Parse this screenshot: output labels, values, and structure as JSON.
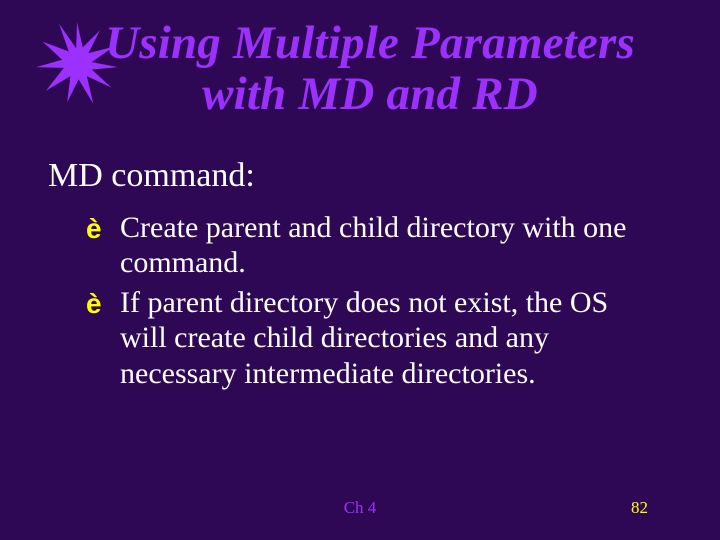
{
  "title": {
    "line1": "Using Multiple Parameters",
    "line2": "with MD and RD"
  },
  "subhead": "MD command:",
  "bullets": [
    "Create parent and child directory with one command.",
    "If parent directory does not exist, the OS will create child directories and any necessary intermediate directories."
  ],
  "icons": {
    "bullet_arrow": "è"
  },
  "footer": {
    "chapter": "Ch 4",
    "page": "82"
  }
}
